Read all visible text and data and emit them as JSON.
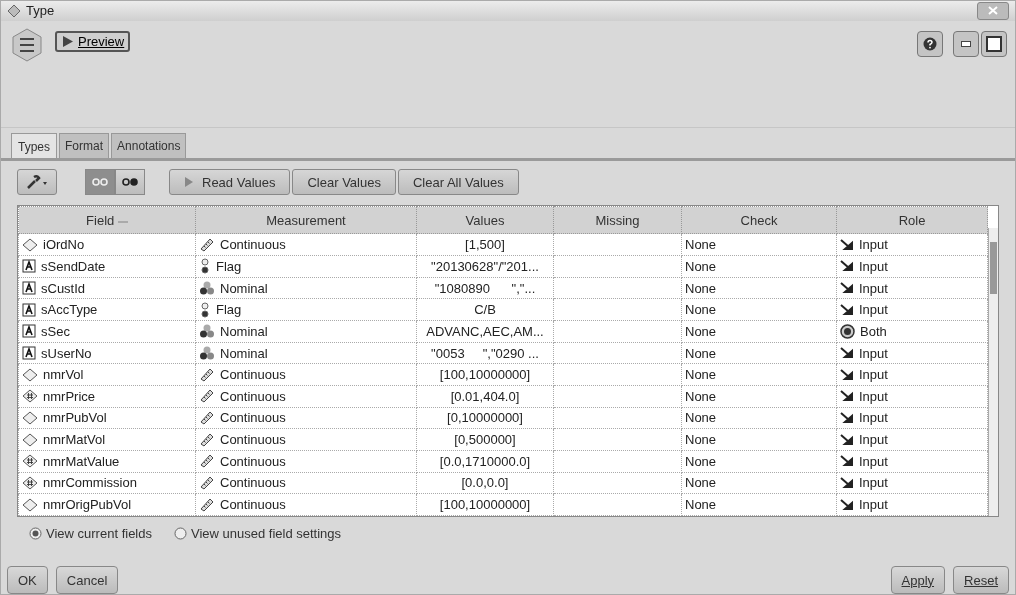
{
  "window": {
    "title": "Type"
  },
  "toolbar": {
    "preview": "Preview"
  },
  "tabs": [
    {
      "label": "Types",
      "selected": true
    },
    {
      "label": "Format",
      "selected": false
    },
    {
      "label": "Annotations",
      "selected": false
    }
  ],
  "actions": [
    {
      "kind": "toggle",
      "selected": true
    },
    {
      "kind": "toggle",
      "selected": false
    },
    {
      "kind": "read",
      "label": "Read Values"
    },
    {
      "kind": "plain",
      "label": "Clear Values"
    },
    {
      "kind": "plain",
      "label": "Clear All Values"
    }
  ],
  "table": {
    "columns": [
      "Field",
      "Measurement",
      "Values",
      "Missing",
      "Check",
      "Role"
    ],
    "rows": [
      {
        "field": {
          "kind": "integer",
          "text": "iOrdNo"
        },
        "measurement": {
          "kind": "continuous",
          "text": "Continuous"
        },
        "values": "[1,500]",
        "check": "None",
        "role": {
          "kind": "input",
          "text": "Input"
        }
      },
      {
        "field": {
          "kind": "string",
          "text": "sSendDate"
        },
        "measurement": {
          "kind": "flag",
          "text": "Flag"
        },
        "values": "\"20130628\"/\"201...",
        "check": "None",
        "role": {
          "kind": "input",
          "text": "Input"
        }
      },
      {
        "field": {
          "kind": "string",
          "text": "sCustId"
        },
        "measurement": {
          "kind": "nominal",
          "text": "Nominal"
        },
        "values": "\"1080890      \",\"...",
        "check": "None",
        "role": {
          "kind": "input",
          "text": "Input"
        }
      },
      {
        "field": {
          "kind": "string",
          "text": "sAccType"
        },
        "measurement": {
          "kind": "flag",
          "text": "Flag"
        },
        "values": "C/B",
        "check": "None",
        "role": {
          "kind": "input",
          "text": "Input"
        }
      },
      {
        "field": {
          "kind": "string",
          "text": "sSec"
        },
        "measurement": {
          "kind": "nominal",
          "text": "Nominal"
        },
        "values": "ADVANC,AEC,AM...",
        "check": "None",
        "role": {
          "kind": "both",
          "text": "Both"
        }
      },
      {
        "field": {
          "kind": "string",
          "text": "sUserNo"
        },
        "measurement": {
          "kind": "nominal",
          "text": "Nominal"
        },
        "values": "\"0053     \",\"0290 ...",
        "check": "None",
        "role": {
          "kind": "input",
          "text": "Input"
        }
      },
      {
        "field": {
          "kind": "integer",
          "text": "nmrVol"
        },
        "measurement": {
          "kind": "continuous",
          "text": "Continuous"
        },
        "values": "[100,10000000]",
        "check": "None",
        "role": {
          "kind": "input",
          "text": "Input"
        }
      },
      {
        "field": {
          "kind": "real",
          "text": "nmrPrice"
        },
        "measurement": {
          "kind": "continuous",
          "text": "Continuous"
        },
        "values": "[0.01,404.0]",
        "check": "None",
        "role": {
          "kind": "input",
          "text": "Input"
        }
      },
      {
        "field": {
          "kind": "integer",
          "text": "nmrPubVol"
        },
        "measurement": {
          "kind": "continuous",
          "text": "Continuous"
        },
        "values": "[0,10000000]",
        "check": "None",
        "role": {
          "kind": "input",
          "text": "Input"
        }
      },
      {
        "field": {
          "kind": "integer",
          "text": "nmrMatVol"
        },
        "measurement": {
          "kind": "continuous",
          "text": "Continuous"
        },
        "values": "[0,500000]",
        "check": "None",
        "role": {
          "kind": "input",
          "text": "Input"
        }
      },
      {
        "field": {
          "kind": "real",
          "text": "nmrMatValue"
        },
        "measurement": {
          "kind": "continuous",
          "text": "Continuous"
        },
        "values": "[0.0,1710000.0]",
        "check": "None",
        "role": {
          "kind": "input",
          "text": "Input"
        }
      },
      {
        "field": {
          "kind": "real",
          "text": "nmrCommission"
        },
        "measurement": {
          "kind": "continuous",
          "text": "Continuous"
        },
        "values": "[0.0,0.0]",
        "check": "None",
        "role": {
          "kind": "input",
          "text": "Input"
        }
      },
      {
        "field": {
          "kind": "integer",
          "text": "nmrOrigPubVol"
        },
        "measurement": {
          "kind": "continuous",
          "text": "Continuous"
        },
        "values": "[100,10000000]",
        "check": "None",
        "role": {
          "kind": "input",
          "text": "Input"
        }
      }
    ]
  },
  "view_options": [
    {
      "label": "View current fields",
      "selected": true
    },
    {
      "label": "View unused field settings",
      "selected": false
    }
  ],
  "buttons_left": [
    "OK",
    "Cancel"
  ],
  "buttons_right": [
    "Apply",
    "Reset"
  ]
}
